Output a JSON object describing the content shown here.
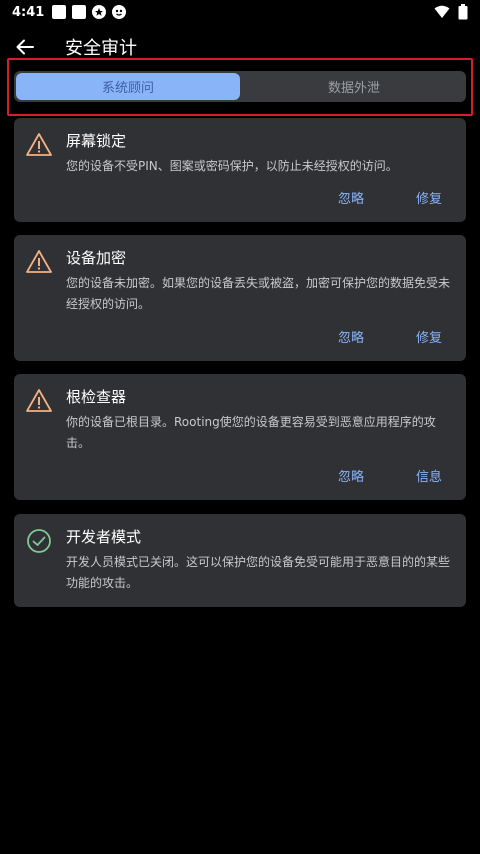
{
  "status_bar": {
    "time": "4:41"
  },
  "app_bar": {
    "title": "安全审计"
  },
  "tabs": [
    {
      "label": "系统顾问",
      "active": true
    },
    {
      "label": "数据外泄",
      "active": false
    }
  ],
  "cards": [
    {
      "title": "屏幕锁定",
      "description": "您的设备不受PIN、图案或密码保护，以防止未经授权的访问。",
      "status": "warning",
      "actions": [
        "忽略",
        "修复"
      ]
    },
    {
      "title": "设备加密",
      "description": "您的设备未加密。如果您的设备丢失或被盗，加密可保护您的数据免受未经授权的访问。",
      "status": "warning",
      "actions": [
        "忽略",
        "修复"
      ]
    },
    {
      "title": "根检查器",
      "description": "你的设备已根目录。Rooting使您的设备更容易受到恶意应用程序的攻击。",
      "status": "warning",
      "actions": [
        "忽略",
        "信息"
      ]
    },
    {
      "title": "开发者模式",
      "description": "开发人员模式已关闭。这可以保护您的设备免受可能用于恶意目的的某些功能的攻击。",
      "status": "ok",
      "actions": []
    }
  ],
  "colors": {
    "accent": "#8ab4f8",
    "warning": "#f4b183",
    "ok": "#81c995",
    "highlight": "#d21f2b",
    "card_bg": "#303134"
  }
}
